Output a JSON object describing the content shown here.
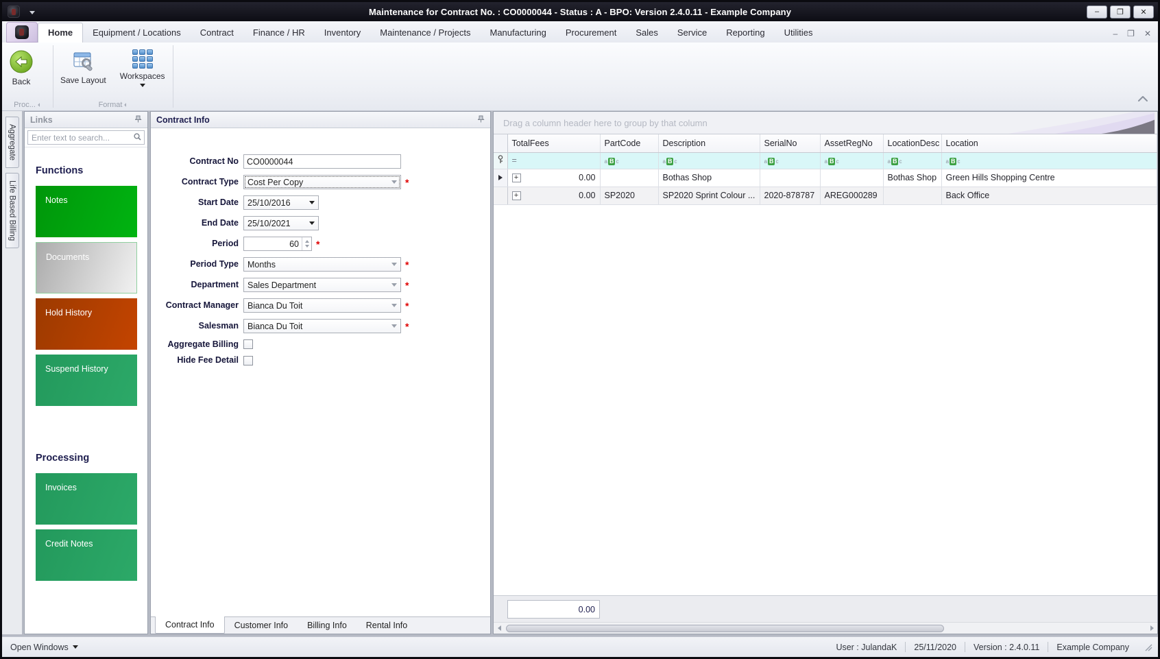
{
  "window": {
    "title": "Maintenance for Contract No. : CO0000044 - Status : A - BPO: Version 2.4.0.11 - Example Company"
  },
  "ribbon": {
    "tabs": [
      {
        "label": "Home",
        "active": true
      },
      {
        "label": "Equipment / Locations"
      },
      {
        "label": "Contract"
      },
      {
        "label": "Finance / HR"
      },
      {
        "label": "Inventory"
      },
      {
        "label": "Maintenance / Projects"
      },
      {
        "label": "Manufacturing"
      },
      {
        "label": "Procurement"
      },
      {
        "label": "Sales"
      },
      {
        "label": "Service"
      },
      {
        "label": "Reporting"
      },
      {
        "label": "Utilities"
      }
    ],
    "buttons": {
      "back": "Back",
      "save_layout": "Save Layout",
      "workspaces": "Workspaces"
    },
    "groups": {
      "processing": "Proc...",
      "format": "Format"
    }
  },
  "side_tabs": {
    "aggregate": "Aggregate",
    "life_based_billing": "Life Based Billing"
  },
  "links_panel": {
    "title": "Links",
    "search_placeholder": "Enter text to search...",
    "functions_heading": "Functions",
    "processing_heading": "Processing",
    "buttons": {
      "notes": "Notes",
      "documents": "Documents",
      "hold_history": "Hold History",
      "suspend_history": "Suspend History",
      "invoices": "Invoices",
      "credit_notes": "Credit Notes"
    },
    "colors": {
      "notes_green": "#00a80d",
      "documents_gray": "#c9c9c9",
      "hold_orange": "#b54000",
      "action_green": "#28a263"
    }
  },
  "contract_panel": {
    "title": "Contract Info",
    "fields": [
      {
        "label": "Contract No",
        "value": "CO0000044",
        "required": false
      },
      {
        "label": "Contract Type",
        "value": "Cost Per Copy",
        "required": true
      },
      {
        "label": "Start Date",
        "value": "25/10/2016",
        "required": false
      },
      {
        "label": "End Date",
        "value": "25/10/2021",
        "required": false
      },
      {
        "label": "Period",
        "value": "60",
        "required": true
      },
      {
        "label": "Period Type",
        "value": "Months",
        "required": true
      },
      {
        "label": "Department",
        "value": "Sales Department",
        "required": true
      },
      {
        "label": "Contract Manager",
        "value": "Bianca Du Toit",
        "required": true
      },
      {
        "label": "Salesman",
        "value": "Bianca Du Toit",
        "required": true
      }
    ],
    "checkboxes": [
      {
        "label": "Aggregate Billing",
        "checked": false
      },
      {
        "label": "Hide Fee Detail",
        "checked": false
      }
    ],
    "tabs": [
      {
        "label": "Contract Info",
        "active": true
      },
      {
        "label": "Customer Info"
      },
      {
        "label": "Billing Info"
      },
      {
        "label": "Rental Info"
      }
    ]
  },
  "grid": {
    "group_hint": "Drag a column header here to group by that column",
    "columns": [
      "TotalFees",
      "PartCode",
      "Description",
      "SerialNo",
      "AssetRegNo",
      "LocationDesc",
      "Location"
    ],
    "rows": [
      {
        "total_fees": "0.00",
        "part_code": "",
        "description": "Bothas Shop",
        "serial_no": "",
        "asset_reg_no": "",
        "location_desc": "Bothas Shop",
        "location": "Green Hills Shopping Centre"
      },
      {
        "total_fees": "0.00",
        "part_code": "SP2020",
        "description": "SP2020 Sprint Colour ...",
        "serial_no": "2020-878787",
        "asset_reg_no": "AREG000289",
        "location_desc": "",
        "location": "Back Office"
      }
    ],
    "summary_total": "0.00"
  },
  "status_bar": {
    "open_windows": "Open Windows",
    "user": "User : JulandaK",
    "date": "25/11/2020",
    "version": "Version : 2.4.0.11",
    "company": "Example Company"
  },
  "icons": {
    "minimize": "–",
    "maximize": "❐",
    "close": "✕",
    "equals_filter": "=",
    "expand_plus": "+",
    "abc_a": "a",
    "abc_b": "B",
    "abc_c": "c",
    "asterisk": "*"
  }
}
